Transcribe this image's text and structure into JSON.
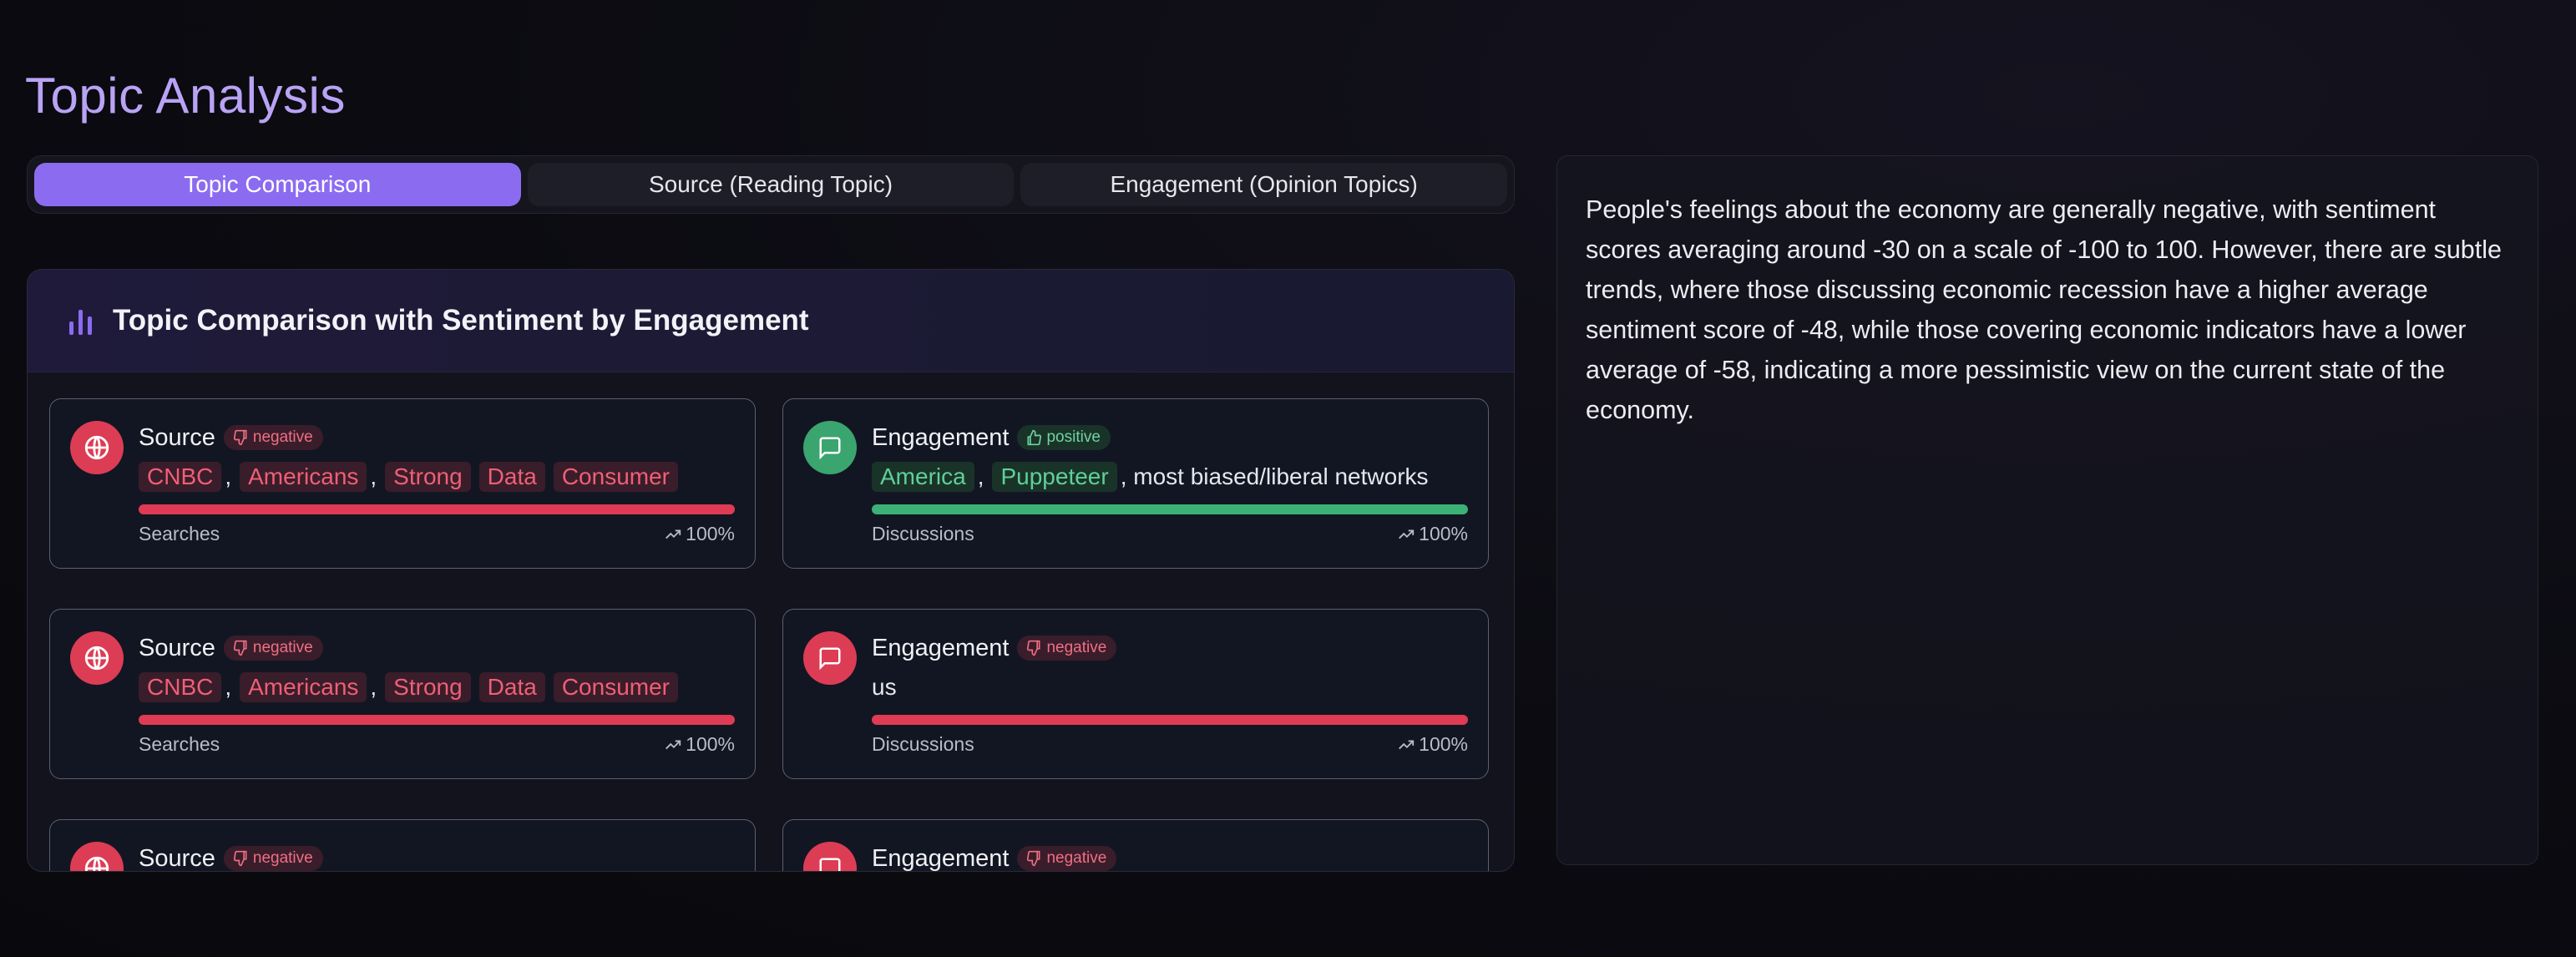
{
  "page": {
    "title": "Topic Analysis"
  },
  "tabs": [
    {
      "label": "Topic Comparison",
      "active": true
    },
    {
      "label": "Source (Reading Topic)",
      "active": false
    },
    {
      "label": "Engagement (Opinion Topics)",
      "active": false
    }
  ],
  "panel": {
    "title": "Topic Comparison with Sentiment by Engagement",
    "icon": "bar-chart-icon"
  },
  "cards": [
    {
      "type": "Source",
      "icon": "globe-icon",
      "sentiment": "negative",
      "keywords": [
        "CNBC",
        "Americans",
        "Strong",
        "Data",
        "Consumer"
      ],
      "metric": "Searches",
      "percent": "100%"
    },
    {
      "type": "Engagement",
      "icon": "message-icon",
      "sentiment": "positive",
      "keywords": [
        "America",
        "Puppeteer"
      ],
      "extra_text": ", most biased/liberal networks",
      "metric": "Discussions",
      "percent": "100%"
    },
    {
      "type": "Source",
      "icon": "globe-icon",
      "sentiment": "negative",
      "keywords": [
        "CNBC",
        "Americans",
        "Strong",
        "Data",
        "Consumer"
      ],
      "metric": "Searches",
      "percent": "100%"
    },
    {
      "type": "Engagement",
      "icon": "message-icon",
      "sentiment": "negative",
      "text": "us",
      "metric": "Discussions",
      "percent": "100%"
    },
    {
      "type": "Source",
      "icon": "globe-icon",
      "sentiment": "negative"
    },
    {
      "type": "Engagement",
      "icon": "message-icon",
      "sentiment": "negative"
    }
  ],
  "summary": {
    "text": "People's feelings about the economy are generally negative, with sentiment scores averaging around -30 on a scale of -100 to 100. However, there are subtle trends, where those discussing economic recession have a higher average sentiment score of -48, while those covering economic indicators have a lower average of -58, indicating a more pessimistic view on the current state of the economy."
  },
  "colors": {
    "accent": "#8b6cf0",
    "negative": "#df3b54",
    "positive": "#3bb176"
  }
}
